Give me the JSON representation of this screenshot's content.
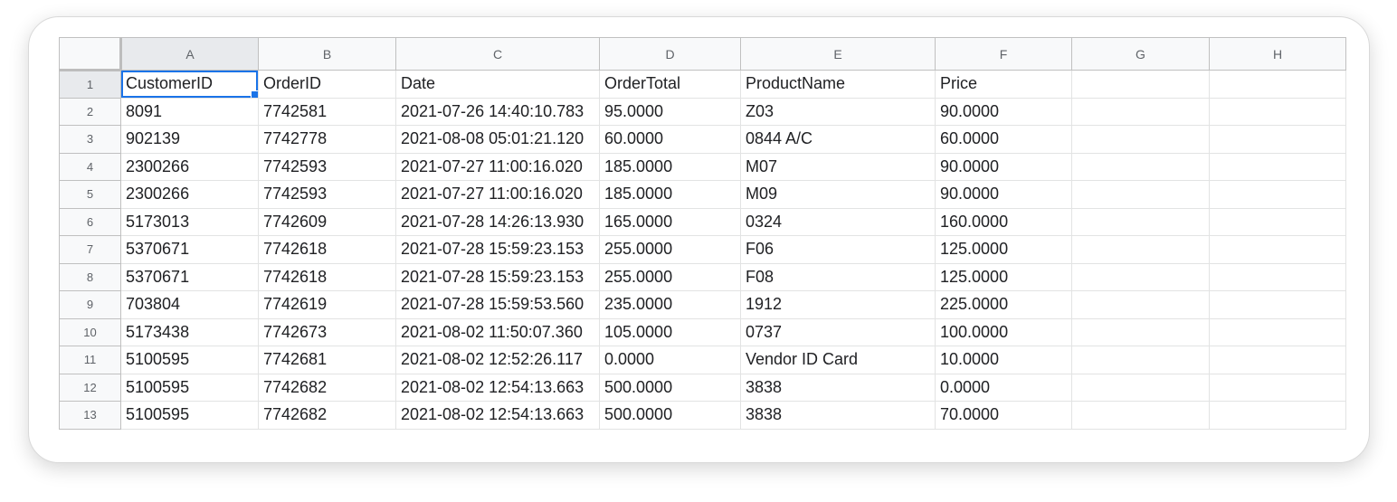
{
  "columns": [
    "A",
    "B",
    "C",
    "D",
    "E",
    "F",
    "G",
    "H"
  ],
  "active_cell": "A1",
  "colors": {
    "selection": "#1a73e8",
    "header_bg": "#f8f9fa",
    "header_selected_bg": "#e8eaed"
  },
  "rows": [
    {
      "num": "1",
      "cells": [
        "CustomerID",
        "OrderID",
        "Date",
        "OrderTotal",
        "ProductName",
        "Price",
        "",
        ""
      ]
    },
    {
      "num": "2",
      "cells": [
        "8091",
        "7742581",
        "2021-07-26 14:40:10.783",
        "95.0000",
        "Z03",
        "90.0000",
        "",
        ""
      ]
    },
    {
      "num": "3",
      "cells": [
        "902139",
        "7742778",
        "2021-08-08 05:01:21.120",
        "60.0000",
        "0844 A/C",
        "60.0000",
        "",
        ""
      ]
    },
    {
      "num": "4",
      "cells": [
        "2300266",
        "7742593",
        "2021-07-27 11:00:16.020",
        "185.0000",
        "M07",
        "90.0000",
        "",
        ""
      ]
    },
    {
      "num": "5",
      "cells": [
        "2300266",
        "7742593",
        "2021-07-27 11:00:16.020",
        "185.0000",
        "M09",
        "90.0000",
        "",
        ""
      ]
    },
    {
      "num": "6",
      "cells": [
        "5173013",
        "7742609",
        "2021-07-28 14:26:13.930",
        "165.0000",
        "0324",
        "160.0000",
        "",
        ""
      ]
    },
    {
      "num": "7",
      "cells": [
        "5370671",
        "7742618",
        "2021-07-28 15:59:23.153",
        "255.0000",
        "F06",
        "125.0000",
        "",
        ""
      ]
    },
    {
      "num": "8",
      "cells": [
        "5370671",
        "7742618",
        "2021-07-28 15:59:23.153",
        "255.0000",
        "F08",
        "125.0000",
        "",
        ""
      ]
    },
    {
      "num": "9",
      "cells": [
        "703804",
        "7742619",
        "2021-07-28 15:59:53.560",
        "235.0000",
        "1912",
        "225.0000",
        "",
        ""
      ]
    },
    {
      "num": "10",
      "cells": [
        "5173438",
        "7742673",
        "2021-08-02 11:50:07.360",
        "105.0000",
        "0737",
        "100.0000",
        "",
        ""
      ]
    },
    {
      "num": "11",
      "cells": [
        "5100595",
        "7742681",
        "2021-08-02 12:52:26.117",
        "0.0000",
        "Vendor ID Card",
        "10.0000",
        "",
        ""
      ]
    },
    {
      "num": "12",
      "cells": [
        "5100595",
        "7742682",
        "2021-08-02 12:54:13.663",
        "500.0000",
        "3838",
        "0.0000",
        "",
        ""
      ]
    },
    {
      "num": "13",
      "cells": [
        "5100595",
        "7742682",
        "2021-08-02 12:54:13.663",
        "500.0000",
        "3838",
        "70.0000",
        "",
        ""
      ]
    }
  ]
}
